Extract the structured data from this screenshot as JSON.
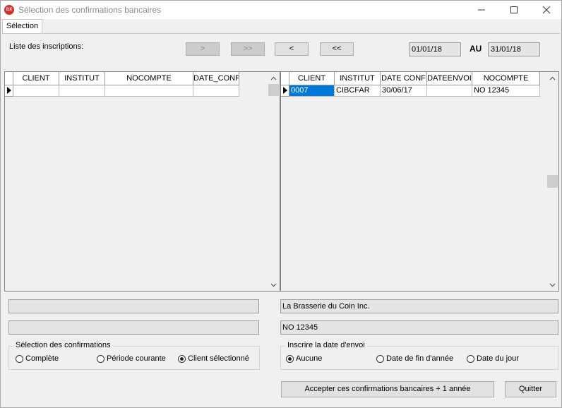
{
  "window": {
    "title": "Sélection des confirmations bancaires",
    "app_icon_text": "DX"
  },
  "tabs": [
    {
      "label": "Sélection",
      "active": true
    }
  ],
  "list_label": "Liste des inscriptions:",
  "nav_buttons": [
    {
      "label": ">",
      "enabled": false
    },
    {
      "label": ">>",
      "enabled": false
    },
    {
      "label": "<",
      "enabled": true
    },
    {
      "label": "<<",
      "enabled": true
    }
  ],
  "date_range": {
    "from": "01/01/18",
    "separator": "AU",
    "to": "31/01/18"
  },
  "left_grid": {
    "columns": [
      "CLIENT",
      "INSTITUT",
      "NOCOMPTE",
      "DATE_CONF"
    ],
    "rows": [
      [
        "",
        "",
        "",
        ""
      ]
    ]
  },
  "right_grid": {
    "columns": [
      "CLIENT",
      "INSTITUT",
      "DATE CONF",
      "DATEENVOI",
      "NOCOMPTE"
    ],
    "rows": [
      [
        "0007",
        "CIBCFAR",
        "30/06/17",
        "",
        "NO 12345"
      ]
    ]
  },
  "left_info": {
    "line1": "",
    "line2": ""
  },
  "right_info": {
    "name": "La Brasserie du Coin Inc.",
    "account": "NO 12345"
  },
  "selection_group": {
    "title": "Sélection des confirmations",
    "options": [
      {
        "label": "Complète",
        "selected": false
      },
      {
        "label": "Période courante",
        "selected": false
      },
      {
        "label": "Client sélectionné",
        "selected": true
      }
    ]
  },
  "send_date_group": {
    "title": "Inscrire la date d'envoi",
    "options": [
      {
        "label": "Aucune",
        "selected": true
      },
      {
        "label": "Date de fin d'année",
        "selected": false
      },
      {
        "label": "Date du jour",
        "selected": false
      }
    ]
  },
  "buttons": {
    "accept": "Accepter ces confirmations bancaires + 1 année",
    "quit": "Quitter"
  },
  "colors": {
    "selection": "#0078d7",
    "app_icon": "#d9302c"
  }
}
